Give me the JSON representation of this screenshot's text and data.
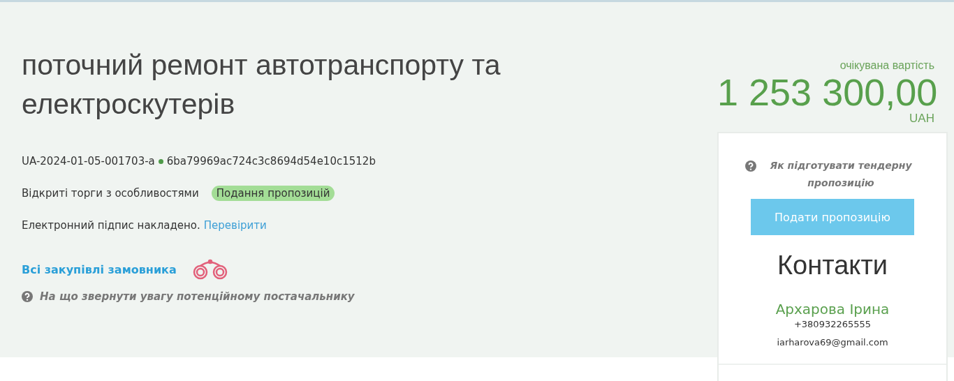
{
  "tender": {
    "title": "поточний ремонт автотранспорту та електроскутерів",
    "id": "UA-2024-01-05-001703-a",
    "hash": "6ba79969ac724c3c8694d54e10c1512b",
    "procedure": "Відкриті торги з особливостями",
    "status": "Подання пропозицій",
    "signature": {
      "text": "Електронний підпис накладено.",
      "link": "Перевірити"
    },
    "customer_link": "Всі закупівлі замовника",
    "supplier_help": "На що звернути увагу потенційному постачальнику"
  },
  "value": {
    "label": "очікувана вартість",
    "amount": "1 253 300,00",
    "currency": "UAH"
  },
  "sidebar": {
    "help": "Як підготувати тендерну пропозицію",
    "submit_button": "Подати пропозицію",
    "contacts_title": "Контакти",
    "contact": {
      "name": "Архарова Ірина",
      "phone": "+380932265555",
      "email": "iarharova69@gmail.com"
    }
  }
}
